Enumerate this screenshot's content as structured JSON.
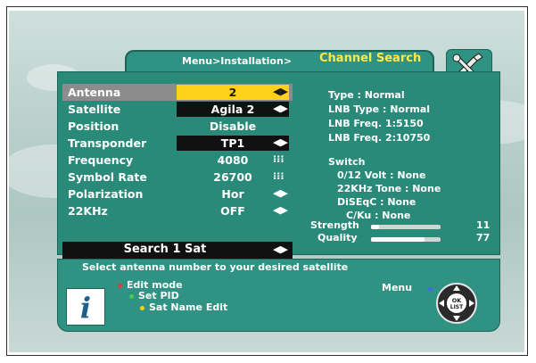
{
  "header": {
    "breadcrumb": "Menu>Installation>",
    "title": "Channel Search"
  },
  "menu": {
    "rows": [
      {
        "label": "Antenna",
        "value": "2",
        "control": "◀▶"
      },
      {
        "label": "Satellite",
        "value": "Agila 2",
        "control": "◀▶"
      },
      {
        "label": "Position",
        "value": "Disable",
        "control": ""
      },
      {
        "label": "Transponder",
        "value": "TP1",
        "control": "◀▶"
      },
      {
        "label": "Frequency",
        "value": "4080",
        "control": "⁝⁝⁝"
      },
      {
        "label": "Symbol Rate",
        "value": "26700",
        "control": "⁝⁝⁝"
      },
      {
        "label": "Polarization",
        "value": "Hor",
        "control": "◀▶"
      },
      {
        "label": "22KHz",
        "value": "OFF",
        "control": "◀▶"
      }
    ],
    "search_button": "Search 1 Sat",
    "search_control": "◀▶"
  },
  "info": {
    "type": "Type : Normal",
    "lnb_type": "LNB Type : Normal",
    "lnb_freq1": "LNB Freq. 1:5150",
    "lnb_freq2": "LNB Freq. 2:10750",
    "switch_title": "Switch",
    "volt": "0/12 Volt : None",
    "tone": "22KHz Tone : None",
    "diseqc": "DiSEqC : None",
    "cku": "C/Ku : None"
  },
  "meters": {
    "strength_label": "Strength",
    "strength_value": "11",
    "strength_level": 0.11,
    "quality_label": "Quality",
    "quality_value": "77",
    "quality_level": 0.77
  },
  "help": {
    "hint": "Select antenna number to your desired satellite",
    "edit_mode": "Edit mode",
    "set_pid": "Set PID",
    "sat_name_edit": "Sat Name Edit",
    "menu_key": "Menu",
    "nav_label": "OK LIST",
    "info_glyph": "i"
  },
  "colors": {
    "panel": "#2a8a7a",
    "highlight": "#ffd11a",
    "title": "#ffe94a",
    "edit_dot": "#e23a3a",
    "pid_dot": "#3fd04a",
    "sat_dot": "#ffd11a",
    "menu_dot": "#3a6fe2"
  }
}
